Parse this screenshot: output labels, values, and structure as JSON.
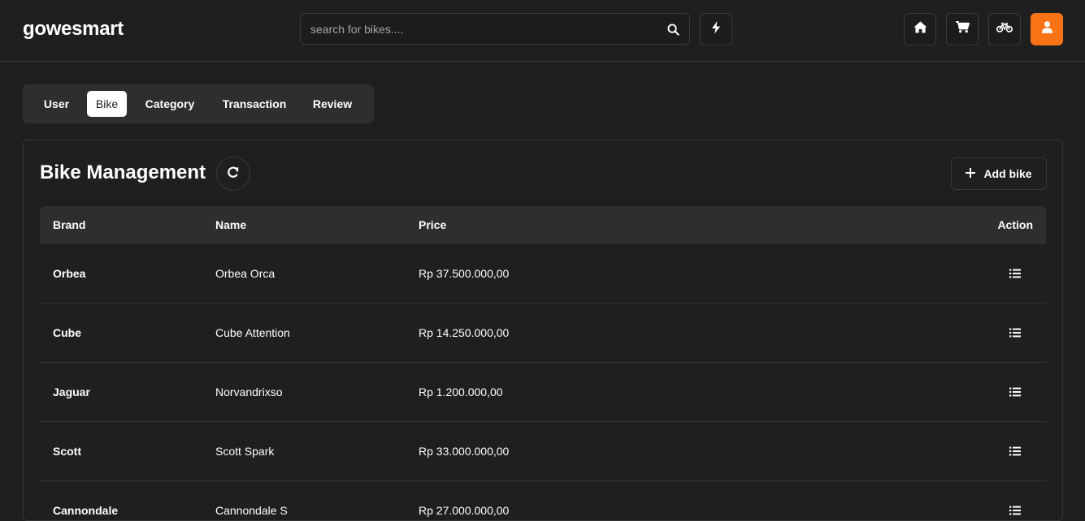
{
  "header": {
    "logo": "gowesmart",
    "search_placeholder": "search for bikes....",
    "icons": [
      "search-icon",
      "bolt-icon",
      "home-icon",
      "cart-icon",
      "bike-icon",
      "user-icon"
    ],
    "accent_color": "#f97316"
  },
  "tabs": [
    {
      "label": "User",
      "active": false
    },
    {
      "label": "Bike",
      "active": true
    },
    {
      "label": "Category",
      "active": false
    },
    {
      "label": "Transaction",
      "active": false
    },
    {
      "label": "Review",
      "active": false
    }
  ],
  "card": {
    "title": "Bike Management",
    "add_label": "Add bike"
  },
  "table": {
    "headers": {
      "brand": "Brand",
      "name": "Name",
      "price": "Price",
      "action": "Action"
    },
    "rows": [
      {
        "brand": "Orbea",
        "name": "Orbea Orca",
        "price": "Rp 37.500.000,00"
      },
      {
        "brand": "Cube",
        "name": "Cube Attention",
        "price": "Rp 14.250.000,00"
      },
      {
        "brand": "Jaguar",
        "name": "Norvandrixso",
        "price": "Rp 1.200.000,00"
      },
      {
        "brand": "Scott",
        "name": "Scott Spark",
        "price": "Rp 33.000.000,00"
      },
      {
        "brand": "Cannondale",
        "name": "Cannondale S",
        "price": "Rp 27.000.000,00"
      }
    ]
  }
}
